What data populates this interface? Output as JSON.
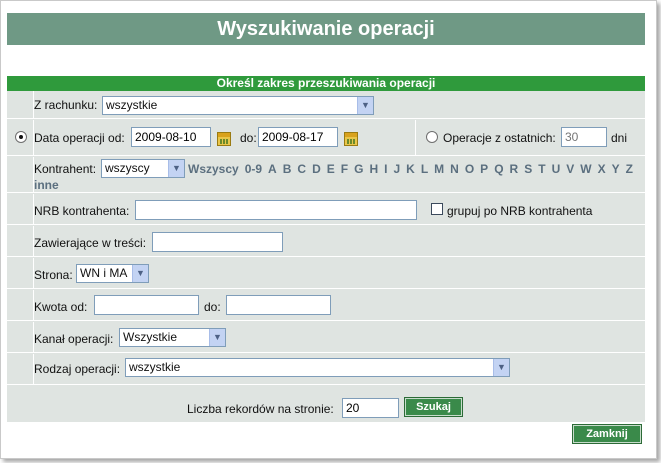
{
  "title": "Wyszukiwanie operacji",
  "section_header": "Określ zakres przeszukiwania operacji",
  "account": {
    "label": "Z rachunku:",
    "value": "wszystkie"
  },
  "date_range": {
    "label_from": "Data operacji od:",
    "from_value": "2009-08-10",
    "label_to": "do:",
    "to_value": "2009-08-17",
    "selected": true
  },
  "recent": {
    "label": "Operacje z ostatnich:",
    "placeholder": "30",
    "unit": "dni",
    "selected": false
  },
  "contractor": {
    "label": "Kontrahent:",
    "value": "wszyscy",
    "letters": [
      "Wszyscy",
      "0-9",
      "A",
      "B",
      "C",
      "D",
      "E",
      "F",
      "G",
      "H",
      "I",
      "J",
      "K",
      "L",
      "M",
      "N",
      "O",
      "P",
      "Q",
      "R",
      "S",
      "T",
      "U",
      "V",
      "W",
      "X",
      "Y",
      "Z"
    ],
    "letters_extra": "inne"
  },
  "nrb": {
    "label": "NRB kontrahenta:",
    "value": "",
    "group_label": "grupuj po NRB kontrahenta",
    "group_checked": false
  },
  "content": {
    "label": "Zawierające w treści:",
    "value": ""
  },
  "side": {
    "label": "Strona:",
    "value": "WN i MA"
  },
  "amount": {
    "label_from": "Kwota od:",
    "from_value": "",
    "label_to": "do:",
    "to_value": ""
  },
  "channel": {
    "label": "Kanał operacji:",
    "value": "Wszystkie"
  },
  "op_type": {
    "label": "Rodzaj operacji:",
    "value": "wszystkie"
  },
  "records": {
    "label": "Liczba rekordów na stronie:",
    "value": "20"
  },
  "buttons": {
    "search": "Szukaj",
    "close": "Zamknij"
  }
}
